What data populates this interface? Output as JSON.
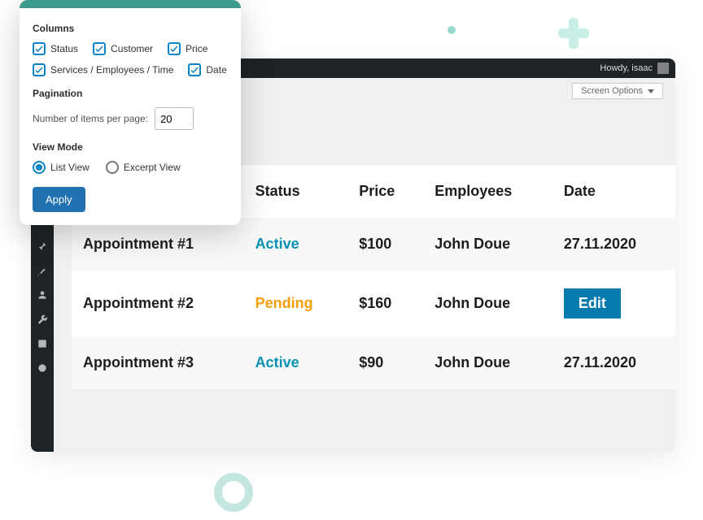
{
  "topbar": {
    "howdy": "Howdy, isaac"
  },
  "screen_options_btn": "Screen Options",
  "table": {
    "headers": {
      "status": "Status",
      "price": "Price",
      "employees": "Employees",
      "date": "Date"
    },
    "rows": [
      {
        "title": "Appointment #1",
        "status": "Active",
        "status_class": "active",
        "price": "$100",
        "employee": "John Doue",
        "date": "27.11.2020",
        "edit": false
      },
      {
        "title": "Appointment #2",
        "status": "Pending",
        "status_class": "pending",
        "price": "$160",
        "employee": "John Doue",
        "date": "",
        "edit": true,
        "edit_label": "Edit"
      },
      {
        "title": "Appointment #3",
        "status": "Active",
        "status_class": "active",
        "price": "$90",
        "employee": "John Doue",
        "date": "27.11.2020",
        "edit": false
      }
    ]
  },
  "popup": {
    "columns_heading": "Columns",
    "columns": [
      {
        "label": "Status",
        "checked": true
      },
      {
        "label": "Customer",
        "checked": true
      },
      {
        "label": "Price",
        "checked": true
      },
      {
        "label": "Services / Employees / Time",
        "checked": true
      },
      {
        "label": "Date",
        "checked": true
      }
    ],
    "pagination_heading": "Pagination",
    "per_page_label": "Number of items per page:",
    "per_page_value": "20",
    "view_mode_heading": "View Mode",
    "views": [
      {
        "label": "List View",
        "selected": true
      },
      {
        "label": "Excerpt View",
        "selected": false
      }
    ],
    "apply": "Apply"
  },
  "colors": {
    "active": "#0891b2",
    "pending": "#f59e0b",
    "primary": "#2271b1"
  }
}
